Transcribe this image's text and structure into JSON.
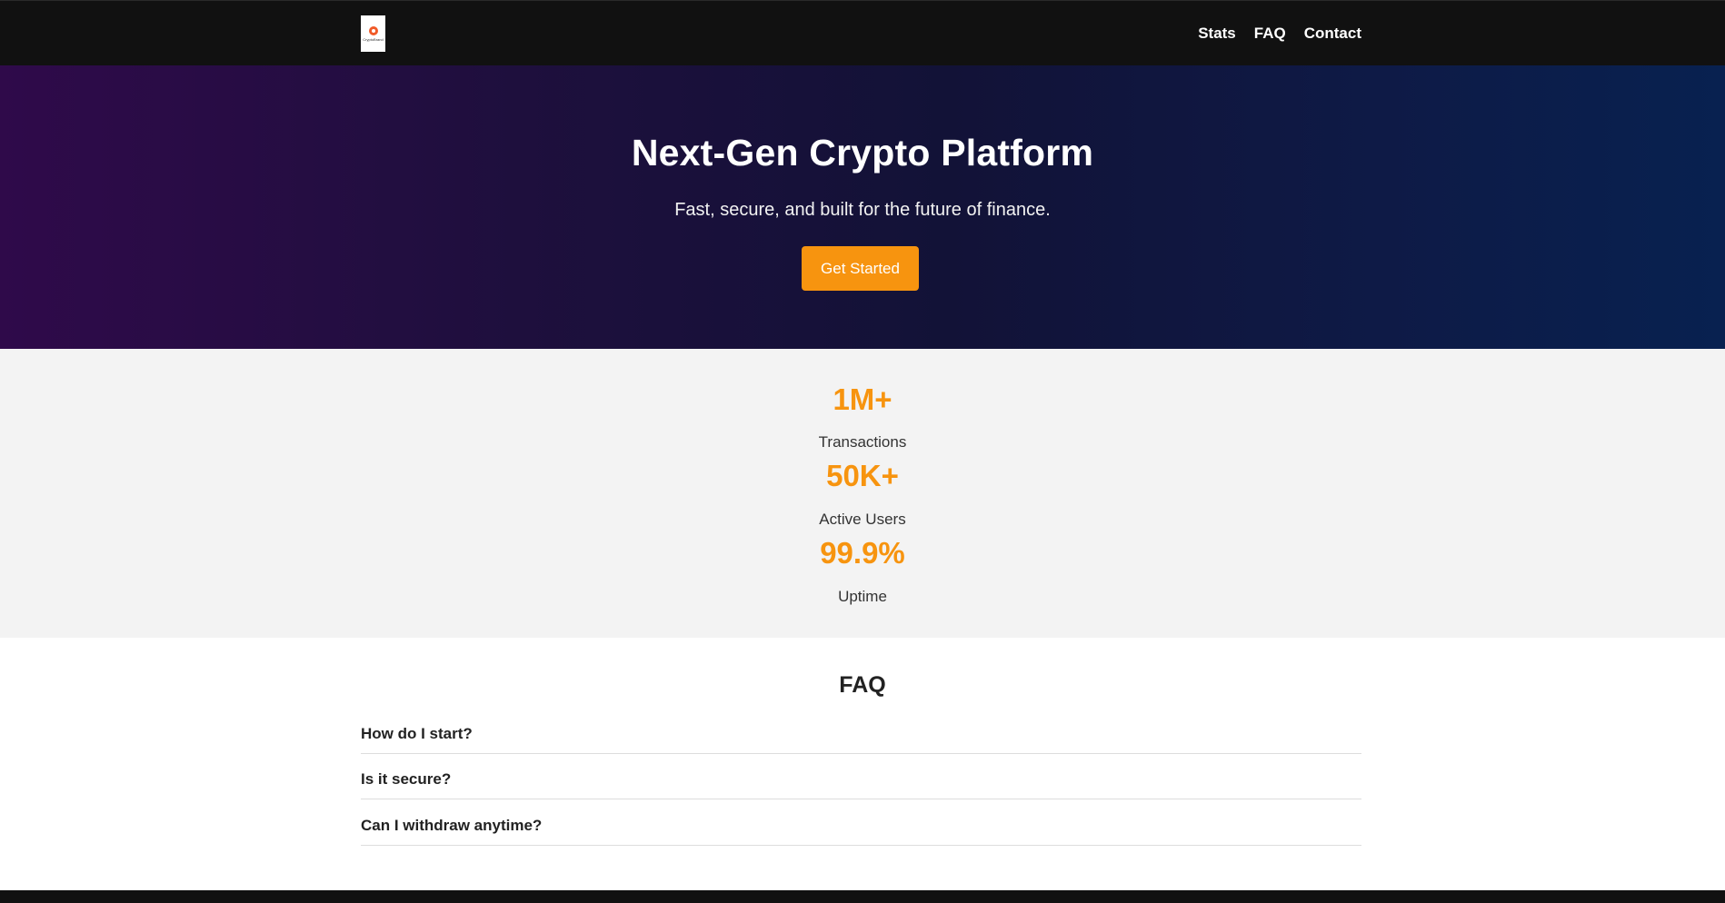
{
  "brand": {
    "logo_text": "CryptoBrand"
  },
  "nav": {
    "items": [
      "Stats",
      "FAQ",
      "Contact"
    ]
  },
  "hero": {
    "title": "Next-Gen Crypto Platform",
    "subtitle": "Fast, secure, and built for the future of finance.",
    "cta_label": "Get Started"
  },
  "stats": [
    {
      "value": "1M+",
      "label": "Transactions"
    },
    {
      "value": "50K+",
      "label": "Active Users"
    },
    {
      "value": "99.9%",
      "label": "Uptime"
    }
  ],
  "faq": {
    "title": "FAQ",
    "items": [
      "How do I start?",
      "Is it secure?",
      "Can I withdraw anytime?"
    ]
  },
  "colors": {
    "accent": "#f7940f",
    "nav_bg": "#111111",
    "stats_bg": "#f3f3f3"
  }
}
